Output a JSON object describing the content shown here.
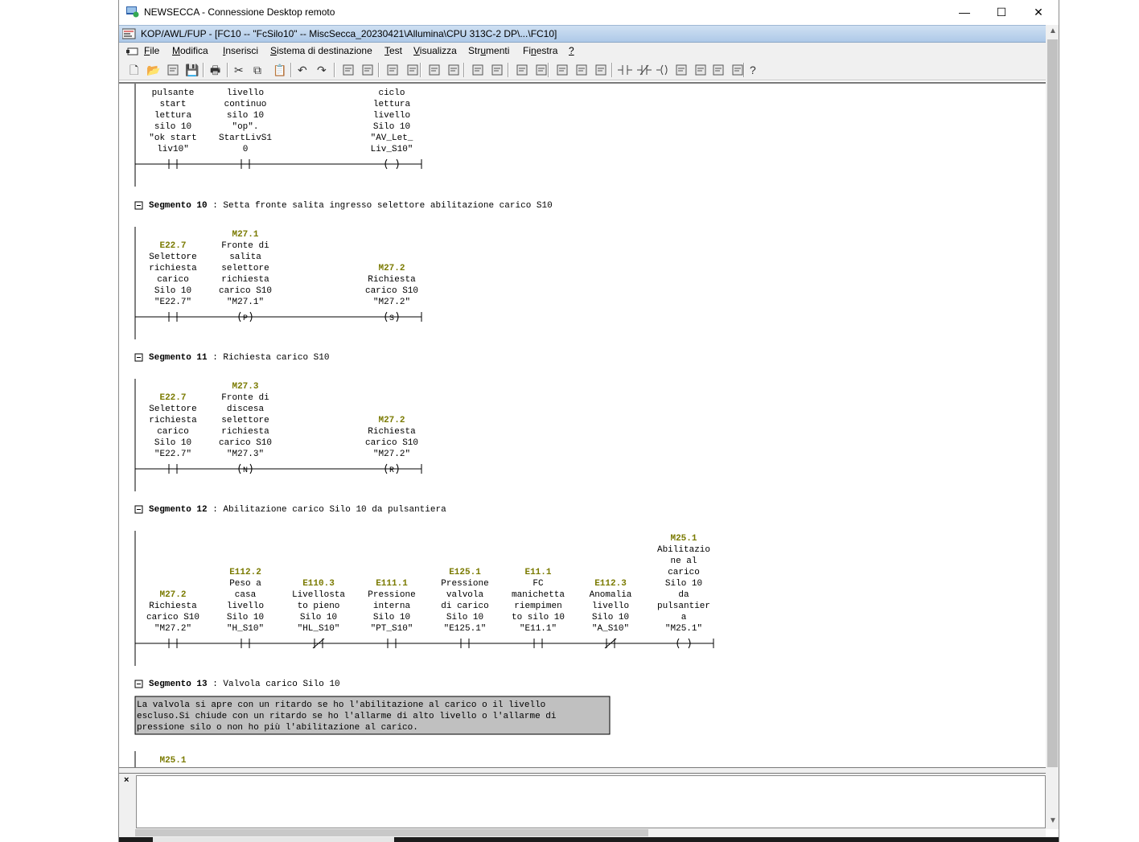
{
  "window": {
    "title": "NEWSECCA - Connessione Desktop remoto",
    "minimize": "—",
    "maximize": "☐",
    "close": "✕"
  },
  "app": {
    "title": "KOP/AWL/FUP  - [FC10 -- \"FcSilo10\" -- MiscSecca_20230421\\Allumina\\CPU 313C-2 DP\\...\\FC10]"
  },
  "menu": [
    {
      "pre": "",
      "u": "F",
      "post": "ile"
    },
    {
      "pre": "",
      "u": "M",
      "post": "odifica"
    },
    {
      "pre": "",
      "u": "I",
      "post": "nserisci"
    },
    {
      "pre": "",
      "u": "S",
      "post": "istema di destinazione"
    },
    {
      "pre": "",
      "u": "T",
      "post": "est"
    },
    {
      "pre": "",
      "u": "V",
      "post": "isualizza"
    },
    {
      "pre": "Str",
      "u": "u",
      "post": "menti"
    },
    {
      "pre": "Fi",
      "u": "n",
      "post": "estra"
    },
    {
      "pre": "",
      "u": "?",
      "post": ""
    }
  ],
  "network9_tail": {
    "contacts": [
      {
        "lines": [
          "pulsante",
          "start",
          "lettura",
          "silo 10",
          "\"ok start",
          "liv10\""
        ],
        "type": "NO"
      },
      {
        "lines": [
          "livello",
          "continuo",
          "silo 10",
          "\"op\".",
          "StartLivS1",
          "0"
        ],
        "type": "NO"
      }
    ],
    "coil": {
      "lines": [
        "ciclo",
        "lettura",
        "livello",
        "Silo 10",
        "\"AV_Let_",
        "Liv_S10\""
      ],
      "symbol": "( )"
    }
  },
  "networks": [
    {
      "label": "Segmento 10",
      "title": "Setta fronte salita ingresso selettore abilitazione carico S10",
      "elements": [
        {
          "addr": "E22.7",
          "lines": [
            "Selettore",
            "richiesta",
            "carico",
            "Silo 10",
            "\"E22.7\""
          ],
          "type": "NO"
        },
        {
          "addr": "M27.1",
          "lines": [
            "Fronte di",
            "salita",
            "selettore",
            "richiesta",
            "carico S10",
            "\"M27.1\""
          ],
          "type": "P",
          "symbol": "(P)"
        }
      ],
      "coil": {
        "addr": "M27.2",
        "lines": [
          "Richiesta",
          "carico S10",
          "\"M27.2\""
        ],
        "symbol": "(S)"
      }
    },
    {
      "label": "Segmento 11",
      "title": "Richiesta carico S10",
      "elements": [
        {
          "addr": "E22.7",
          "lines": [
            "Selettore",
            "richiesta",
            "carico",
            "Silo 10",
            "\"E22.7\""
          ],
          "type": "NO"
        },
        {
          "addr": "M27.3",
          "lines": [
            "Fronte di",
            "discesa",
            "selettore",
            "richiesta",
            "carico S10",
            "\"M27.3\""
          ],
          "type": "N",
          "symbol": "(N)"
        }
      ],
      "coil": {
        "addr": "M27.2",
        "lines": [
          "Richiesta",
          "carico S10",
          "\"M27.2\""
        ],
        "symbol": "(R)"
      }
    },
    {
      "label": "Segmento 12",
      "title": "Abilitazione carico Silo 10 da pulsantiera",
      "elements": [
        {
          "addr": "M27.2",
          "lines": [
            "Richiesta",
            "carico S10",
            "\"M27.2\""
          ],
          "type": "NO"
        },
        {
          "addr": "E112.2",
          "lines": [
            "Peso a",
            "casa",
            "livello",
            "Silo 10",
            "\"H_S10\""
          ],
          "type": "NO"
        },
        {
          "addr": "E110.3",
          "lines": [
            "Livellosta",
            "to pieno",
            "Silo 10",
            "\"HL_S10\""
          ],
          "type": "NC"
        },
        {
          "addr": "E111.1",
          "lines": [
            "Pressione",
            "interna",
            "Silo 10",
            "\"PT_S10\""
          ],
          "type": "NO"
        },
        {
          "addr": "E125.1",
          "lines": [
            "Pressione",
            "valvola",
            "di carico",
            "Silo 10",
            "\"E125.1\""
          ],
          "type": "NO"
        },
        {
          "addr": "E11.1",
          "lines": [
            "FC",
            "manichetta",
            "riempimen",
            "to silo 10",
            "\"E11.1\""
          ],
          "type": "NO"
        },
        {
          "addr": "E112.3",
          "lines": [
            "Anomalia",
            "livello",
            "Silo 10",
            "\"A_S10\""
          ],
          "type": "NC"
        }
      ],
      "coil": {
        "addr": "M25.1",
        "lines": [
          "Abilitazio",
          "ne al",
          "carico",
          "Silo 10",
          "da",
          "pulsantier",
          "a",
          "\"M25.1\""
        ],
        "symbol": "( )"
      }
    },
    {
      "label": "Segmento 13",
      "title": "Valvola carico Silo 10",
      "comment": [
        "La valvola si apre con un ritardo se ho l'abilitazione al carico o il livello",
        "escluso.Si chiude con un ritardo se ho l'allarme di alto livello o l'allarme di",
        "pressione silo o non ho più l'abilitazione al carico."
      ],
      "first_addr": "M25.1"
    }
  ],
  "colors": {
    "address": "#7a7a00",
    "text": "#000000",
    "comment_bg": "#c0c0c0",
    "titlebar_grad": "#cfe0f2"
  },
  "toolbar_icons": [
    "new-icon",
    "open-icon",
    "accessible-nodes-icon",
    "save-icon",
    "print-icon",
    "cut-icon",
    "copy-icon",
    "paste-icon",
    "undo-icon",
    "redo-icon",
    "load-icon",
    "download-icon",
    "monitor-icon",
    "online-icon",
    "network-icon",
    "glasses-icon",
    "prev-icon",
    "next-icon",
    "overview-icon",
    "zoom-icon",
    "kop-icon",
    "awl-icon",
    "fup-icon",
    "no-contact-icon",
    "nc-contact-icon",
    "coil-icon",
    "box-icon",
    "branch-open-icon",
    "branch-close-icon",
    "connection-icon",
    "help-icon"
  ]
}
